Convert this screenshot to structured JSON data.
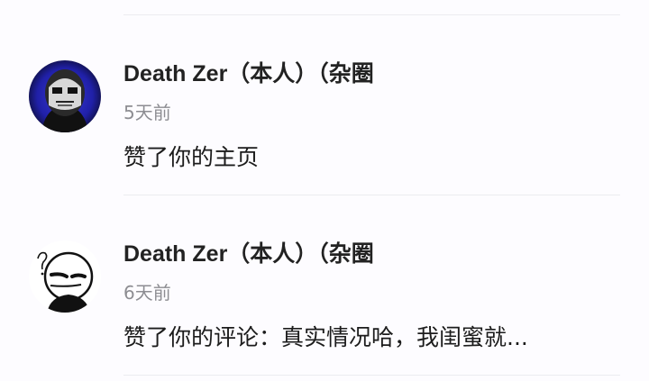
{
  "notifications": [
    {
      "username": "Death Zer（本人）（杂圈",
      "time": "5天前",
      "message": "赞了你的主页",
      "avatar_icon": "dark-mask-avatar-icon"
    },
    {
      "username": "Death Zer（本人）（杂圈",
      "time": "6天前",
      "message": "赞了你的评论：真实情况哈，我闺蜜就...",
      "avatar_icon": "doodle-face-avatar-icon"
    }
  ],
  "colors": {
    "username": "#222222",
    "time": "#8d8d92",
    "message": "#1c1c1c",
    "divider": "#ececf0"
  }
}
